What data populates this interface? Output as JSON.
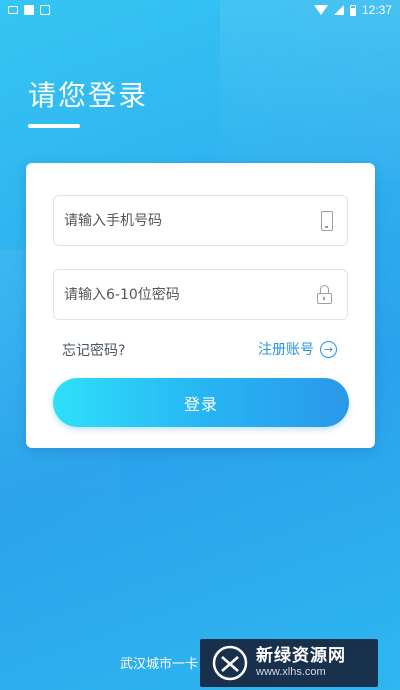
{
  "status_bar": {
    "time": "12:37",
    "icons": [
      "printer-icon",
      "square-icon",
      "notification-box-icon",
      "wifi-icon",
      "signal-icon",
      "battery-icon"
    ]
  },
  "header": {
    "title": "请您登录"
  },
  "login_form": {
    "phone": {
      "value": "",
      "placeholder": "请输入手机号码",
      "icon": "phone-icon"
    },
    "password": {
      "value": "",
      "placeholder": "请输入6-10位密码",
      "icon": "lock-icon"
    },
    "forgot_label": "忘记密码?",
    "register_label": "注册账号",
    "submit_label": "登录"
  },
  "footer": {
    "company": "武汉城市一卡"
  },
  "watermark": {
    "brand": "新绿资源网",
    "url": "www.xlhs.com"
  },
  "colors": {
    "background": "#2fb0ef",
    "accent": "#2a94e6",
    "button_gradient_start": "#2fe0f9",
    "button_gradient_end": "#2a98ea"
  }
}
